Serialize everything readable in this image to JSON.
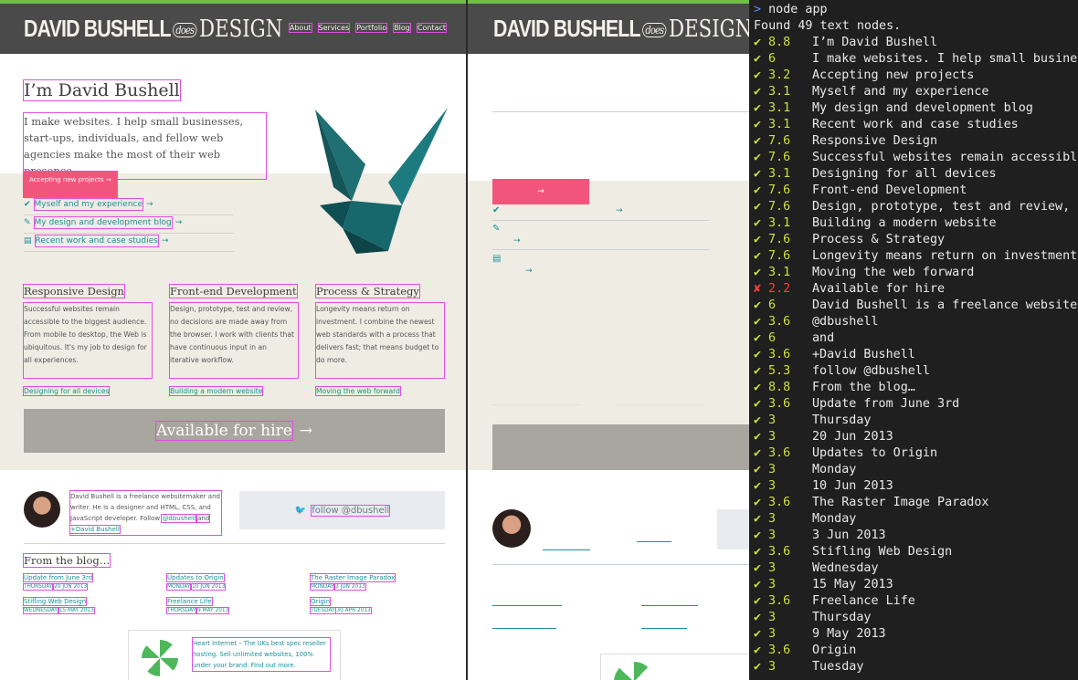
{
  "site": {
    "logo": {
      "name": "DAVID BUSHELL",
      "does": "does",
      "design": "DESIGN"
    },
    "nav": [
      "About",
      "Services",
      "Portfolio",
      "Blog",
      "Contact"
    ],
    "hero_title": "I’m David Bushell",
    "hero_text": "I make websites. I help small businesses, start-ups, individuals, and fellow web agencies make the most of their web presence.",
    "accept_label": "Accepting new projects →",
    "links": [
      {
        "icon": "check-icon",
        "label": "Myself and my experience",
        "arrow": "→"
      },
      {
        "icon": "edit-icon",
        "label": "My design and development blog",
        "arrow": "→"
      },
      {
        "icon": "portfolio-icon",
        "label": "Recent work and case studies",
        "arrow": "→"
      }
    ],
    "columns": [
      {
        "title": "Responsive Design",
        "text": "Successful websites remain accessible to the biggest audience. From mobile to desktop, the Web is ubiquitous. It's my job to design for all experiences.",
        "link": "Designing for all devices"
      },
      {
        "title": "Front-end Development",
        "text": "Design, prototype, test and review, no decisions are made away from the browser. I work with clients that have continuous input in an iterative workflow.",
        "link": "Building a modern website"
      },
      {
        "title": "Process & Strategy",
        "text": "Longevity means return on investment. I combine the newest web standards with a process that delivers fast; that means budget to do more.",
        "link": "Moving the web forward"
      }
    ],
    "hire_label": "Available for hire",
    "hire_arrow": "→",
    "bio": {
      "text": "David Bushell is a freelance websitemaker and writer. He is a designer and HTML, CSS, and JavaScript developer. Follow",
      "handle": "@dbushell",
      "and": "and",
      "gplus": "+David Bushell"
    },
    "follow_label": "follow @dbushell",
    "blog_title": "From the blog…",
    "posts": [
      {
        "title": "Update from June 3rd",
        "day": "Thursday",
        "date": "20 Jun 2013"
      },
      {
        "title": "Updates to Origin",
        "day": "Monday",
        "date": "10 Jun 2013"
      },
      {
        "title": "The Raster Image Paradox",
        "day": "Monday",
        "date": "3 Jun 2013"
      },
      {
        "title": "Stifling Web Design",
        "day": "Wednesday",
        "date": "15 May 2013"
      },
      {
        "title": "Freelance Life",
        "day": "Thursday",
        "date": "9 May 2013"
      },
      {
        "title": "Origin",
        "day": "Tuesday",
        "date": "30 Apr 2013"
      }
    ],
    "ad_text": "Heart Internet – The UKs best spec reseller hosting. Sell unlimited websites, 100% under your brand. Find out more."
  },
  "terminal": {
    "command": "node app",
    "found": "Found 49 text nodes.",
    "lines": [
      {
        "ok": true,
        "score": "8.8",
        "text": "I’m David Bushell"
      },
      {
        "ok": true,
        "score": "6",
        "text": "I make websites. I help small busines"
      },
      {
        "ok": true,
        "score": "3.2",
        "text": "Accepting new projects"
      },
      {
        "ok": true,
        "score": "3.1",
        "text": "Myself and my experience"
      },
      {
        "ok": true,
        "score": "3.1",
        "text": "My design and development blog"
      },
      {
        "ok": true,
        "score": "3.1",
        "text": "Recent work and case studies"
      },
      {
        "ok": true,
        "score": "7.6",
        "text": "Responsive Design"
      },
      {
        "ok": true,
        "score": "7.6",
        "text": "Successful websites remain accessible"
      },
      {
        "ok": true,
        "score": "3.1",
        "text": "Designing for all devices"
      },
      {
        "ok": true,
        "score": "7.6",
        "text": "Front-end Development"
      },
      {
        "ok": true,
        "score": "7.6",
        "text": "Design, prototype, test and review, n"
      },
      {
        "ok": true,
        "score": "3.1",
        "text": "Building a modern website"
      },
      {
        "ok": true,
        "score": "7.6",
        "text": "Process & Strategy"
      },
      {
        "ok": true,
        "score": "7.6",
        "text": "Longevity means return on investment."
      },
      {
        "ok": true,
        "score": "3.1",
        "text": "Moving the web forward"
      },
      {
        "ok": false,
        "score": "2.2",
        "text": "Available for hire"
      },
      {
        "ok": true,
        "score": "6",
        "text": "David Bushell is a freelance websiter"
      },
      {
        "ok": true,
        "score": "3.6",
        "text": "@dbushell"
      },
      {
        "ok": true,
        "score": "6",
        "text": "and"
      },
      {
        "ok": true,
        "score": "3.6",
        "text": "+David Bushell"
      },
      {
        "ok": true,
        "score": "5.3",
        "text": "follow @dbushell"
      },
      {
        "ok": true,
        "score": "8.8",
        "text": "From the blog…"
      },
      {
        "ok": true,
        "score": "3.6",
        "text": "Update from June 3rd"
      },
      {
        "ok": true,
        "score": "3",
        "text": "Thursday"
      },
      {
        "ok": true,
        "score": "3",
        "text": "20 Jun 2013"
      },
      {
        "ok": true,
        "score": "3.6",
        "text": "Updates to Origin"
      },
      {
        "ok": true,
        "score": "3",
        "text": "Monday"
      },
      {
        "ok": true,
        "score": "3",
        "text": "10 Jun 2013"
      },
      {
        "ok": true,
        "score": "3.6",
        "text": "The Raster Image Paradox"
      },
      {
        "ok": true,
        "score": "3",
        "text": "Monday"
      },
      {
        "ok": true,
        "score": "3",
        "text": "3 Jun 2013"
      },
      {
        "ok": true,
        "score": "3.6",
        "text": "Stifling Web Design"
      },
      {
        "ok": true,
        "score": "3",
        "text": "Wednesday"
      },
      {
        "ok": true,
        "score": "3",
        "text": "15 May 2013"
      },
      {
        "ok": true,
        "score": "3.6",
        "text": "Freelance Life"
      },
      {
        "ok": true,
        "score": "3",
        "text": "Thursday"
      },
      {
        "ok": true,
        "score": "3",
        "text": "9 May 2013"
      },
      {
        "ok": true,
        "score": "3.6",
        "text": "Origin"
      },
      {
        "ok": true,
        "score": "3",
        "text": "Tuesday"
      }
    ]
  },
  "colors": {
    "accent": "#1d8f95",
    "pink": "#f2557b",
    "ok": "#cde03a",
    "bad": "#ff3b3b",
    "prompt": "#5a8cff"
  }
}
